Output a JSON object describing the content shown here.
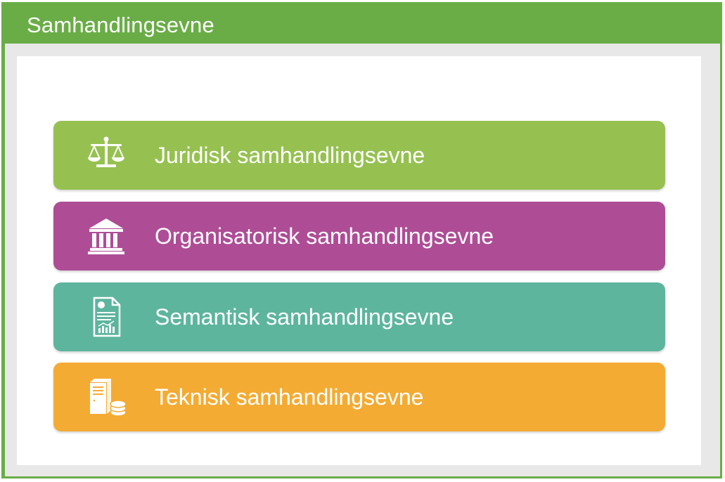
{
  "title": "Samhandlingsevne",
  "layers": [
    {
      "label": "Juridisk samhandlingsevne",
      "icon": "scales-icon",
      "color": "#96c151"
    },
    {
      "label": "Organisatorisk samhandlingsevne",
      "icon": "building-icon",
      "color": "#ae4d96"
    },
    {
      "label": "Semantisk samhandlingsevne",
      "icon": "document-chart-icon",
      "color": "#5db59e"
    },
    {
      "label": "Teknisk samhandlingsevne",
      "icon": "server-database-icon",
      "color": "#f4ab33"
    }
  ]
}
